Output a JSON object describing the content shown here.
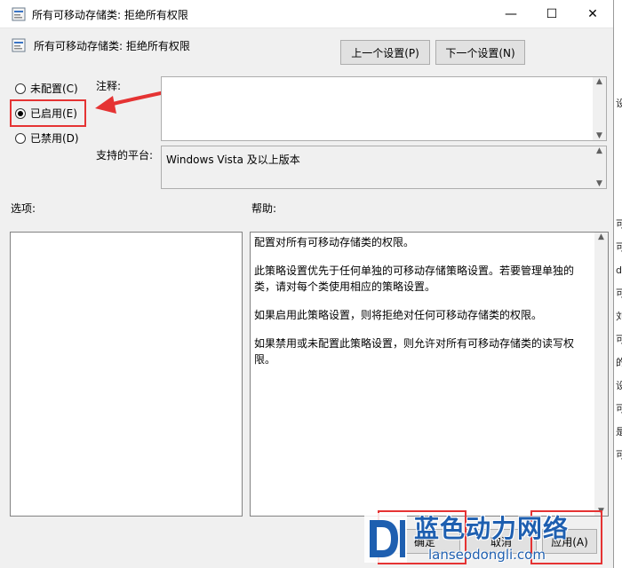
{
  "window": {
    "title": "所有可移动存储类: 拒绝所有权限",
    "minimize": "—",
    "maximize": "☐",
    "close": "✕"
  },
  "header": {
    "policy_name": "所有可移动存储类: 拒绝所有权限",
    "prev_button": "上一个设置(P)",
    "next_button": "下一个设置(N)"
  },
  "state": {
    "options": [
      {
        "label": "未配置(C)",
        "checked": false
      },
      {
        "label": "已启用(E)",
        "checked": true
      },
      {
        "label": "已禁用(D)",
        "checked": false
      }
    ]
  },
  "comment": {
    "label": "注释:",
    "value": ""
  },
  "platform": {
    "label": "支持的平台:",
    "value": "Windows Vista 及以上版本"
  },
  "options_section": {
    "label": "选项:"
  },
  "help_section": {
    "label": "帮助:",
    "paragraphs": [
      "配置对所有可移动存储类的权限。",
      "此策略设置优先于任何单独的可移动存储策略设置。若要管理单独的类，请对每个类使用相应的策略设置。",
      "如果启用此策略设置，则将拒绝对任何可移动存储类的权限。",
      "如果禁用或未配置此策略设置，则允许对所有可移动存储类的读写权限。"
    ]
  },
  "footer": {
    "ok": "确定",
    "cancel": "取消",
    "apply": "应用(A)"
  },
  "watermark": {
    "logo_text": "蓝色动力网络",
    "url": "lanseodongli.com"
  },
  "background_window": {
    "chars": [
      "设",
      "可",
      "可",
      "d",
      "可",
      "刘",
      "可",
      "的",
      "设",
      "可",
      "是",
      "可"
    ]
  },
  "colors": {
    "annotation_red": "#e53333",
    "watermark_blue": "#1e5fb0"
  }
}
